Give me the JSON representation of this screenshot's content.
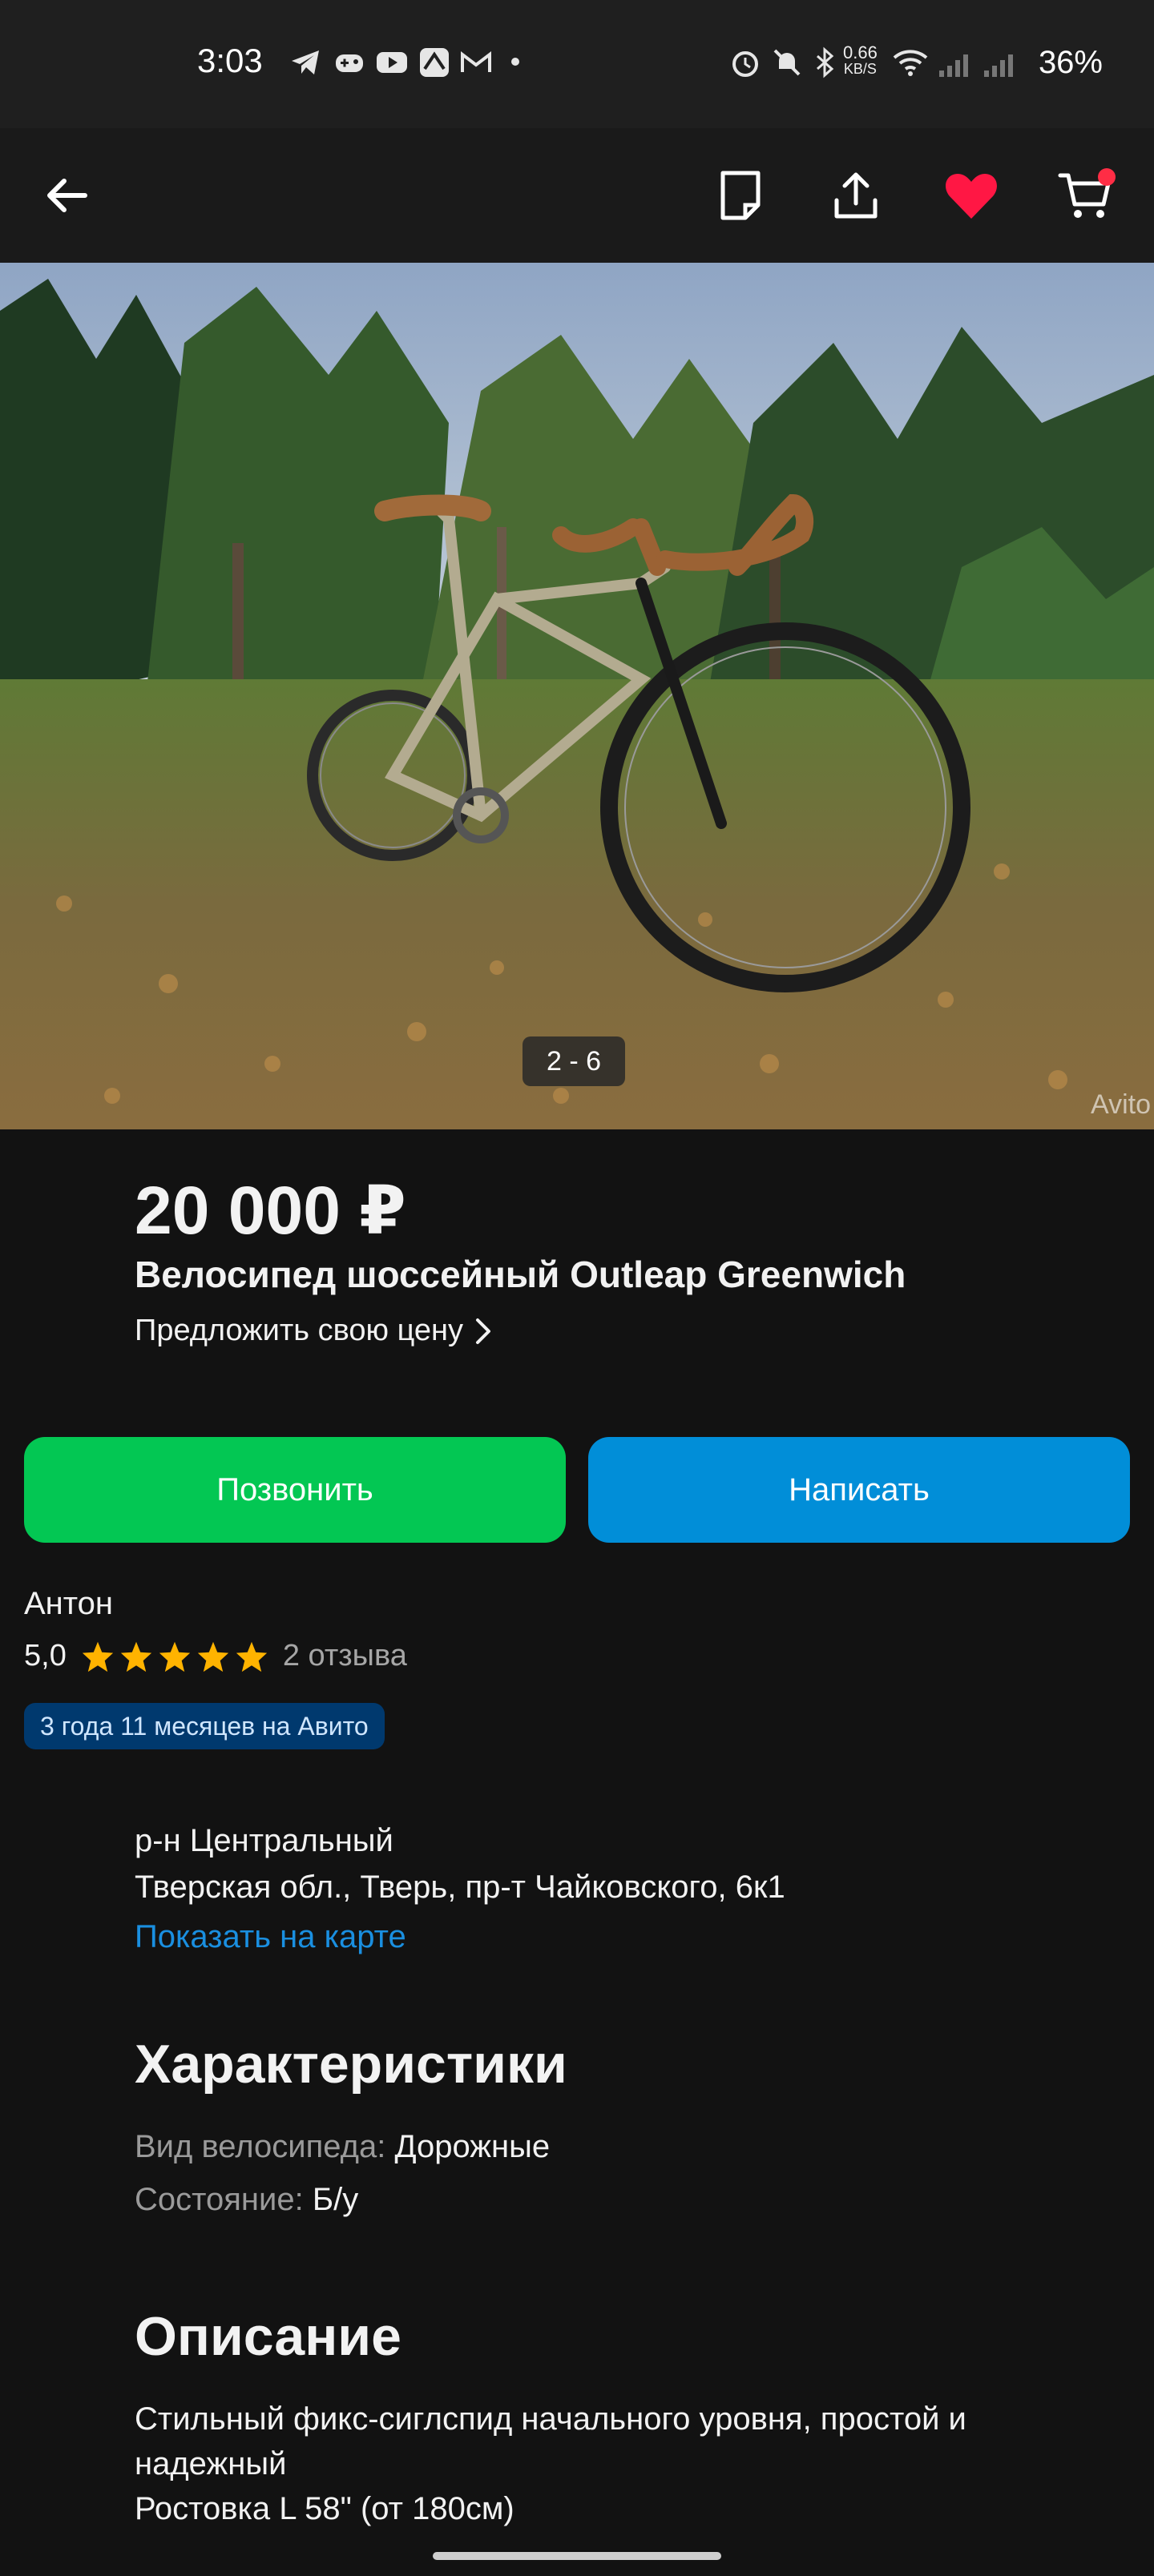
{
  "status_bar": {
    "time": "3:03",
    "net_speed_value": "0.66",
    "net_speed_unit": "KB/S",
    "battery": "36%"
  },
  "toolbar": {
    "icons": [
      "back-arrow-icon",
      "note-icon",
      "share-icon",
      "heart-icon",
      "cart-icon"
    ],
    "favorite_color": "#ff1744"
  },
  "gallery": {
    "counter": "2 - 6",
    "watermark": "Avito"
  },
  "listing": {
    "price": "20 000 ₽",
    "title": "Велосипед шоссейный Outleap Greenwich",
    "offer_price_link": "Предложить свою цену"
  },
  "actions": {
    "call_label": "Позвонить",
    "write_label": "Написать",
    "call_color": "#03c753",
    "write_color": "#018ed8"
  },
  "seller": {
    "name": "Антон",
    "rating": "5,0",
    "stars": 5,
    "reviews": "2 отзыва",
    "since": "3 года 11 месяцев на Авито"
  },
  "location": {
    "district": "р-н Центральный",
    "address": "Тверская обл., Тверь, пр-т Чайковского, 6к1",
    "map_link": "Показать на карте"
  },
  "characteristics": {
    "title": "Характеристики",
    "items": [
      {
        "label": "Вид велосипеда:",
        "value": "Дорожные"
      },
      {
        "label": "Состояние:",
        "value": "Б/у"
      }
    ]
  },
  "description": {
    "title": "Описание",
    "lines": [
      "Стильный фикс-сиглспид начального уровня, простой и",
      "надежный",
      "Ростовка L 58\" (от 180см)"
    ]
  }
}
